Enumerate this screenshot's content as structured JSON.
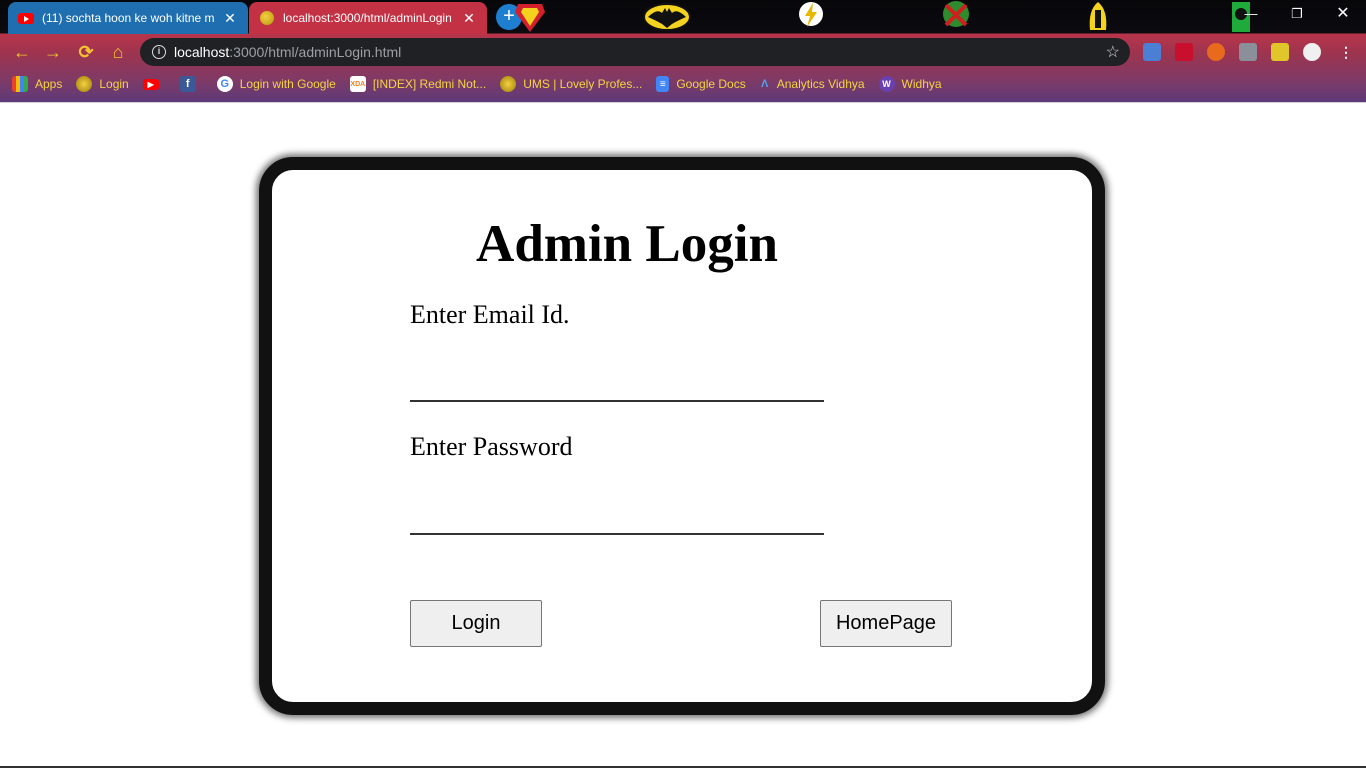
{
  "browser": {
    "tabs": [
      {
        "title": "(11) sochta hoon ke woh kitne m",
        "active": false
      },
      {
        "title": "localhost:3000/html/adminLogin",
        "active": true
      }
    ],
    "address": {
      "host": "localhost",
      "path": ":3000/html/adminLogin.html"
    },
    "bookmarks": [
      {
        "label": "Apps",
        "icon": "apps-grid-icon"
      },
      {
        "label": "Login",
        "icon": "globe-icon"
      },
      {
        "label": "",
        "icon": "youtube-icon"
      },
      {
        "label": "",
        "icon": "facebook-icon"
      },
      {
        "label": "Login with Google",
        "icon": "google-icon"
      },
      {
        "label": "[INDEX] Redmi Not...",
        "icon": "xda-icon"
      },
      {
        "label": "UMS | Lovely Profes...",
        "icon": "globe-icon"
      },
      {
        "label": "Google Docs",
        "icon": "docs-icon"
      },
      {
        "label": "Analytics Vidhya",
        "icon": "analytics-icon"
      },
      {
        "label": "Widhya",
        "icon": "widhya-icon"
      }
    ],
    "colors": {
      "tab_inactive": "#1f6fb0",
      "tab_active": "#c23244",
      "bookmark_text": "#f5d442"
    }
  },
  "page": {
    "title": "Admin Login",
    "email_label": "Enter Email Id.",
    "email_value": "",
    "password_label": "Enter Password",
    "password_value": "",
    "login_button": "Login",
    "homepage_button": "HomePage"
  }
}
